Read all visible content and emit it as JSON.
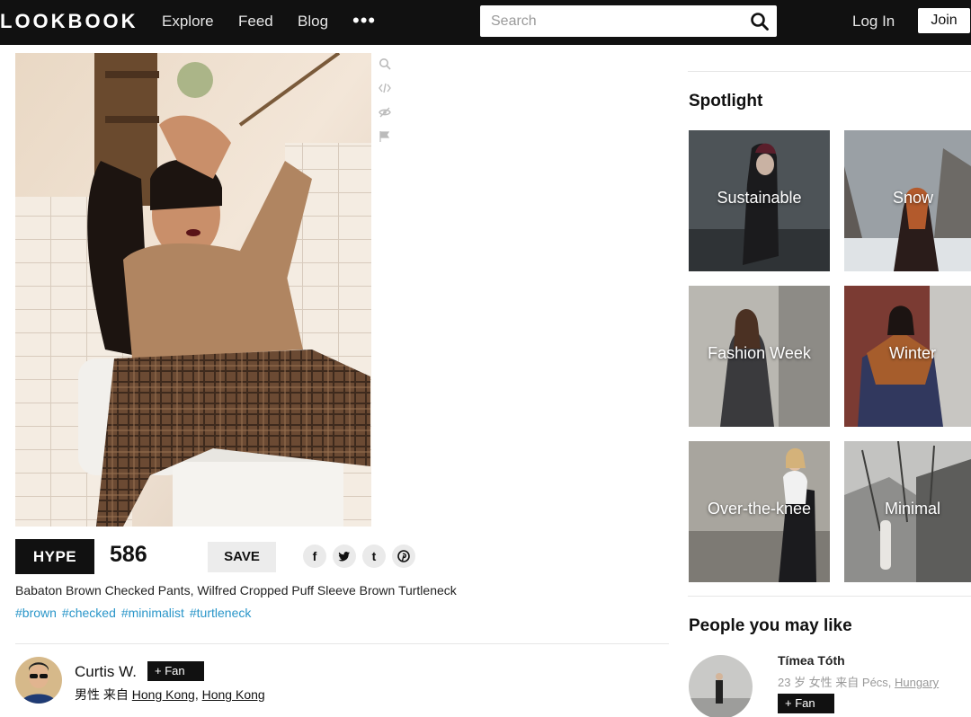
{
  "header": {
    "logo": "LOOKBOOK",
    "nav": [
      "Explore",
      "Feed",
      "Blog"
    ],
    "more": "•••",
    "search_placeholder": "Search",
    "login": "Log In",
    "join": "Join"
  },
  "look": {
    "hype_label": "HYPE",
    "hype_count": "586",
    "save_label": "SAVE",
    "share": [
      "f",
      "t",
      "t",
      "p"
    ],
    "caption": "Babaton Brown Checked Pants, Wilfred Cropped Puff Sleeve Brown Turtleneck",
    "tags": [
      "#brown",
      "#checked",
      "#minimalist",
      "#turtleneck"
    ]
  },
  "author": {
    "name": "Curtis W.",
    "fan_label": "+ Fan",
    "info_prefix": "男性 来自 ",
    "city": "Hong Kong",
    "sep": ", ",
    "country": "Hong Kong"
  },
  "spotlight": {
    "title": "Spotlight",
    "tiles": [
      "Sustainable",
      "Snow",
      "Fashion Week",
      "Winter",
      "Over-the-knee",
      "Minimal"
    ]
  },
  "people": {
    "title": "People you may like",
    "name": "Tímea Tóth",
    "info_prefix": "23 岁 女性 来自 Pécs, ",
    "country": "Hungary",
    "fan_label": "+ Fan"
  },
  "colors": {
    "topbar": "#111111",
    "tag": "#2a96c9"
  }
}
